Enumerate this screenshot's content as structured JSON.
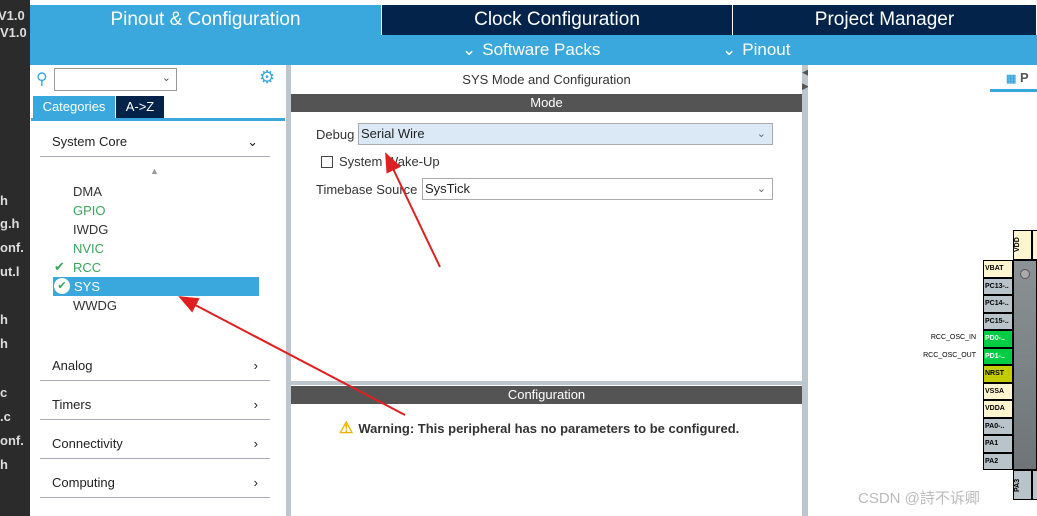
{
  "background_editor": {
    "fragments": [
      "V1.0",
      "V1.0",
      "h",
      "g.h",
      "onf.",
      "ut.l",
      "h",
      "h",
      "c",
      ".c",
      "onf.",
      "h"
    ]
  },
  "tabs": [
    {
      "label": "Pinout & Configuration",
      "active": true
    },
    {
      "label": "Clock Configuration"
    },
    {
      "label": "Project Manager"
    }
  ],
  "subbar": {
    "software_packs": "Software Packs",
    "pinout": "Pinout"
  },
  "left": {
    "search_value": "",
    "view_tabs": [
      "Categories",
      "A->Z"
    ],
    "sections": [
      {
        "label": "System Core",
        "expanded": true
      },
      {
        "label": "Analog"
      },
      {
        "label": "Timers"
      },
      {
        "label": "Connectivity"
      },
      {
        "label": "Computing"
      }
    ],
    "system_core_items": [
      {
        "label": "DMA",
        "status": "none"
      },
      {
        "label": "GPIO",
        "status": "configured"
      },
      {
        "label": "IWDG",
        "status": "none"
      },
      {
        "label": "NVIC",
        "status": "configured"
      },
      {
        "label": "RCC",
        "status": "checked"
      },
      {
        "label": "SYS",
        "status": "selected"
      },
      {
        "label": "WWDG",
        "status": "none"
      }
    ]
  },
  "middle": {
    "title": "SYS Mode and Configuration",
    "mode_header": "Mode",
    "debug_label": "Debug",
    "debug_value": "Serial Wire",
    "wakeup_label": "System Wake-Up",
    "wakeup_checked": false,
    "timebase_label": "Timebase Source",
    "timebase_value": "SysTick",
    "config_header": "Configuration",
    "warning": "Warning: This peripheral has no parameters to be configured."
  },
  "right": {
    "tab_label": "P",
    "top_pins": [
      "VDD"
    ],
    "left_pins": [
      {
        "label": "VBAT",
        "color": "yellow"
      },
      {
        "label": "PC13-..",
        "color": "grey"
      },
      {
        "label": "PC14-..",
        "color": "grey"
      },
      {
        "label": "PC15-..",
        "color": "grey"
      },
      {
        "label": "PD0-..",
        "color": "green",
        "signal": "RCC_OSC_IN"
      },
      {
        "label": "PD1-..",
        "color": "green",
        "signal": "RCC_OSC_OUT"
      },
      {
        "label": "NRST",
        "color": "olive"
      },
      {
        "label": "VSSA",
        "color": "yellow"
      },
      {
        "label": "VDDA",
        "color": "yellow"
      },
      {
        "label": "PA0-..",
        "color": "grey"
      },
      {
        "label": "PA1",
        "color": "grey"
      },
      {
        "label": "PA2",
        "color": "grey"
      }
    ],
    "bottom_pins": [
      "PA3"
    ]
  },
  "watermark": "CSDN @詩不诉卿",
  "colors": {
    "accent": "#3aa8dc",
    "dark_tab": "#03234b",
    "configured": "#3aa55a",
    "arrow": "#e02020"
  }
}
